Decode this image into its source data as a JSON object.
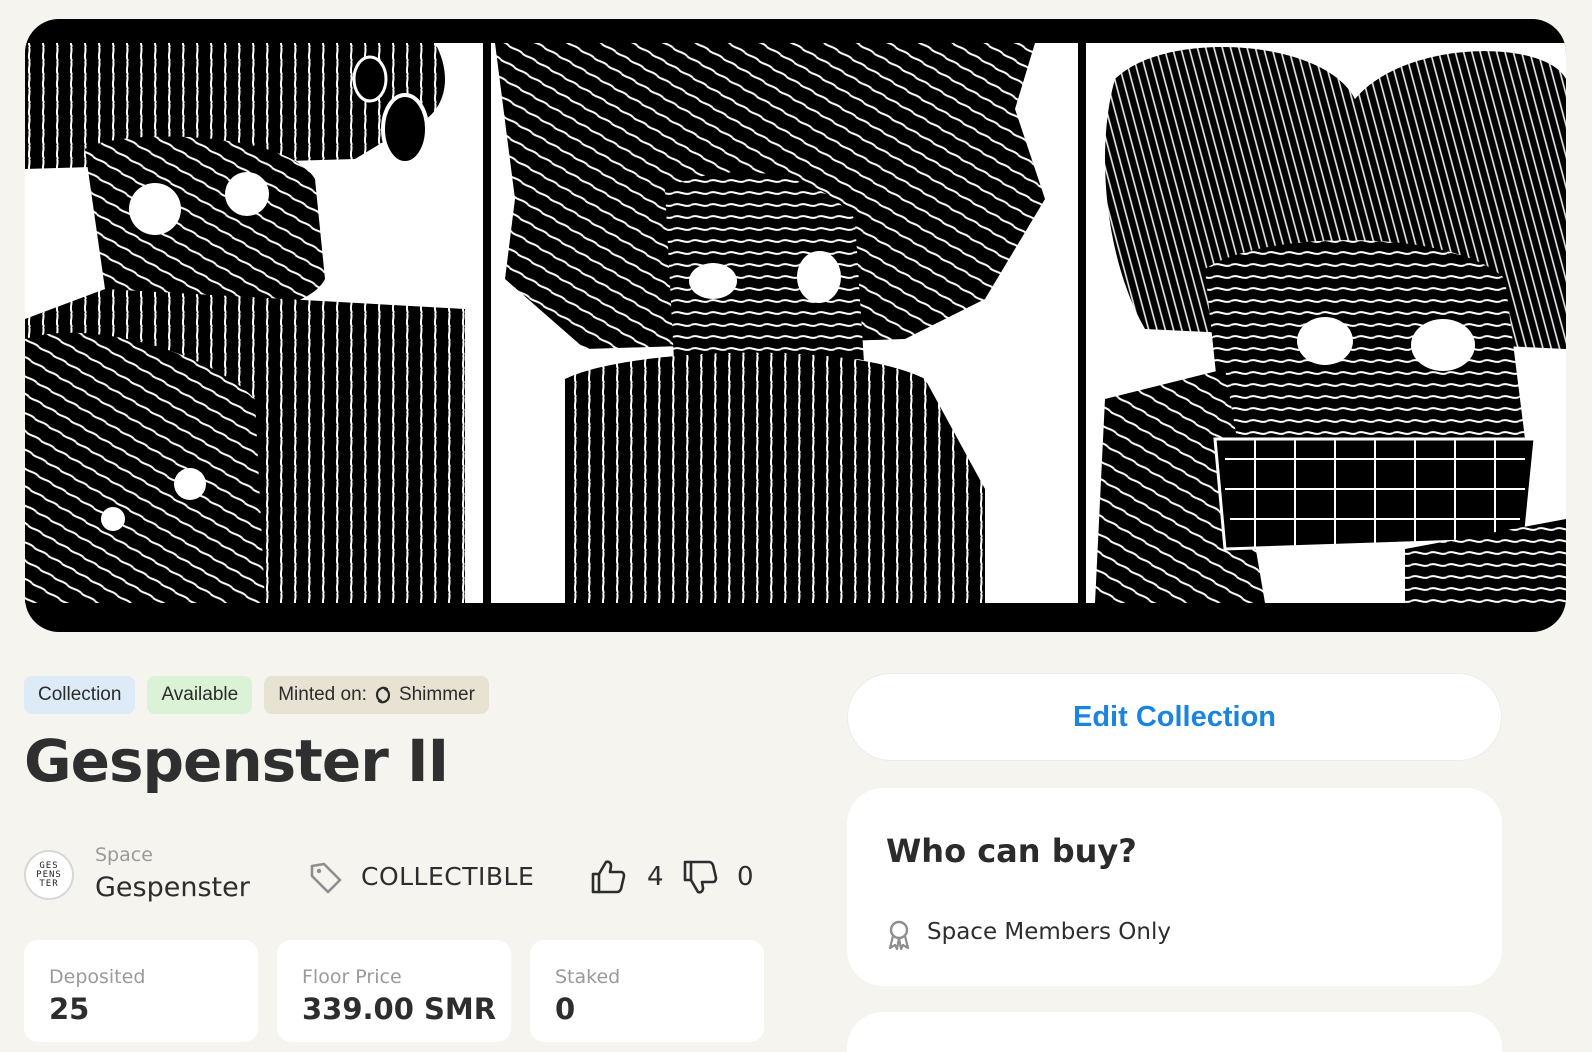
{
  "badges": {
    "collection": "Collection",
    "available": "Available",
    "minted_prefix": "Minted on:",
    "network": "Shimmer"
  },
  "collection": {
    "title": "Gespenster II",
    "space_label": "Space",
    "space_name": "Gespenster",
    "avatar_text": "GES PENS TER",
    "category": "COLLECTIBLE",
    "upvotes": "4",
    "downvotes": "0"
  },
  "stats": [
    {
      "label": "Deposited",
      "value": "25"
    },
    {
      "label": "Floor Price",
      "value": "339.00 SMR"
    },
    {
      "label": "Staked",
      "value": "0"
    }
  ],
  "sidebar": {
    "edit_button": "Edit Collection",
    "buy_title": "Who can buy?",
    "buy_requirement": "Space Members Only"
  },
  "icons": {
    "network": "shimmer-icon",
    "category": "tag-icon",
    "upvote": "thumbs-up-icon",
    "downvote": "thumbs-down-icon",
    "requirement": "award-ribbon-icon"
  },
  "colors": {
    "accent": "#1b85dd",
    "collection_badge": "#dcebf6",
    "available_badge": "#dcf2d6",
    "minted_badge": "#e8e2d3",
    "background": "#f5f4ef"
  }
}
